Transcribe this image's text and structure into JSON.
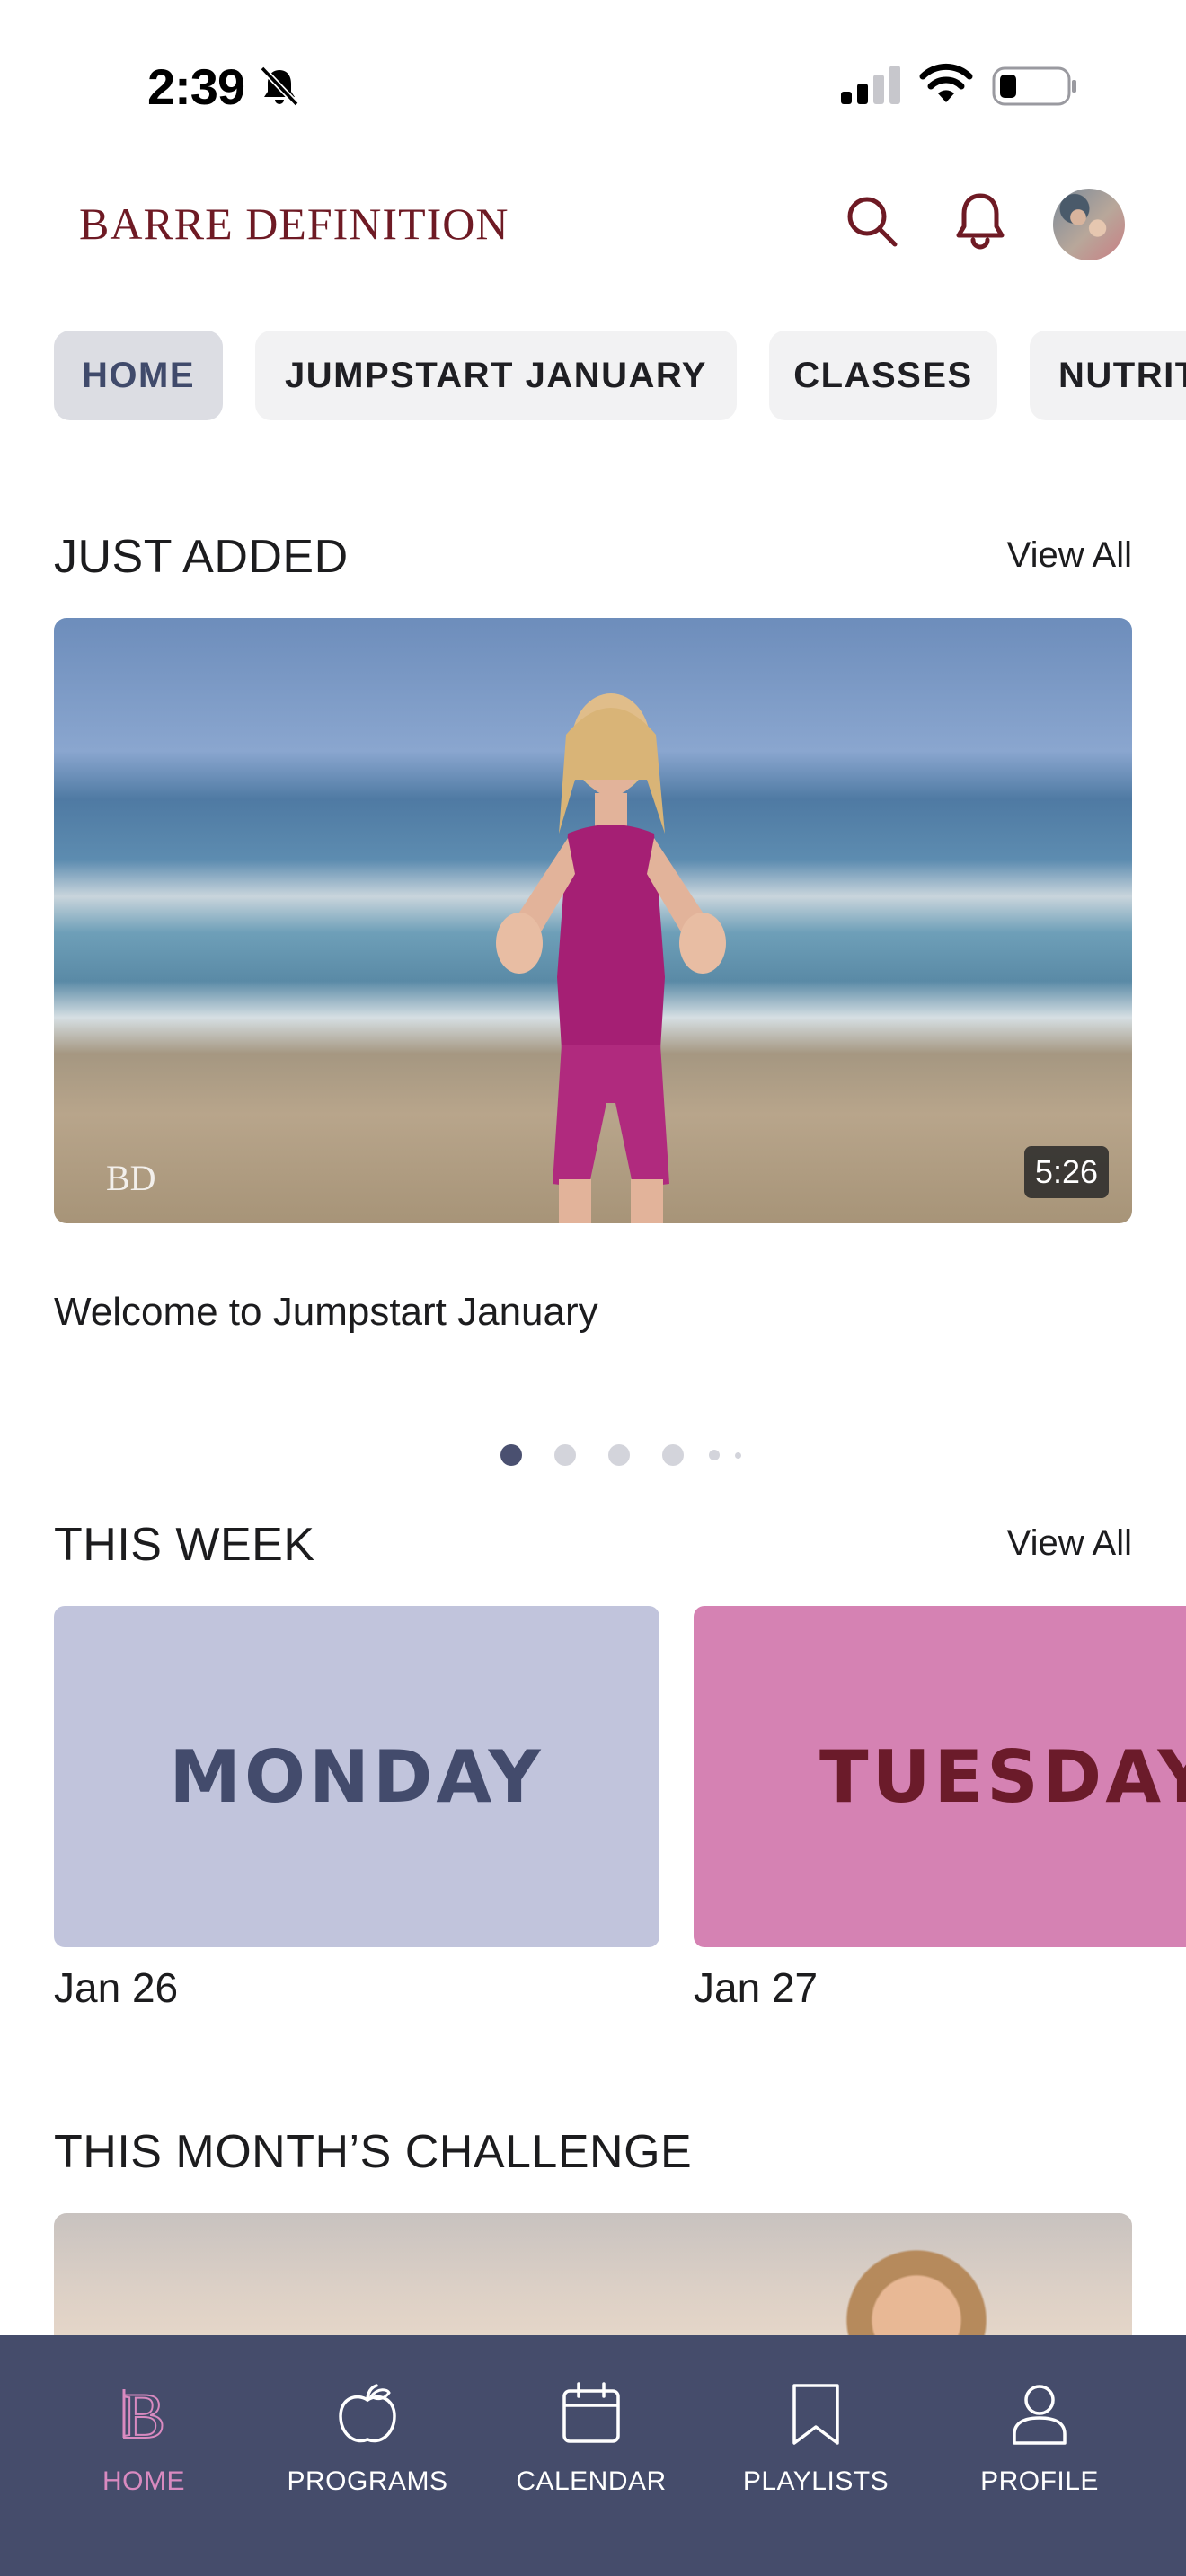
{
  "status": {
    "time": "2:39",
    "icons": [
      "bell-slash-icon",
      "cellular-signal-icon",
      "wifi-icon",
      "battery-icon"
    ]
  },
  "header": {
    "brand": "BARRE DEFINITION",
    "icons": [
      "search-icon",
      "notification-bell-icon",
      "profile-avatar"
    ]
  },
  "tabs": [
    {
      "label": "HOME",
      "active": true
    },
    {
      "label": "JUMPSTART JANUARY",
      "active": false
    },
    {
      "label": "CLASSES",
      "active": false
    },
    {
      "label": "NUTRITION",
      "active": false
    }
  ],
  "just_added": {
    "title": "JUST ADDED",
    "view_all": "View All",
    "video": {
      "title": "Welcome to Jumpstart January",
      "duration": "5:26",
      "watermark": "BD"
    },
    "carousel": {
      "count": 6,
      "active_index": 0
    }
  },
  "this_week": {
    "title": "THIS WEEK",
    "view_all": "View All",
    "days": [
      {
        "day": "MONDAY",
        "date": "Jan 26"
      },
      {
        "day": "TUESDAY",
        "date": "Jan 27"
      }
    ]
  },
  "challenge": {
    "title": "THIS MONTH’S CHALLENGE"
  },
  "bottom_nav": [
    {
      "label": "HOME",
      "icon": "bd-logo-icon",
      "active": true
    },
    {
      "label": "PROGRAMS",
      "icon": "apple-icon",
      "active": false
    },
    {
      "label": "CALENDAR",
      "icon": "calendar-icon",
      "active": false
    },
    {
      "label": "PLAYLISTS",
      "icon": "bookmark-icon",
      "active": false
    },
    {
      "label": "PROFILE",
      "icon": "person-icon",
      "active": false
    }
  ],
  "colors": {
    "brand": "#6e1a24",
    "nav_background": "#454c6b",
    "nav_active": "#d98ac0",
    "monday_card": "#c1c4dc",
    "tuesday_card": "#d582b3"
  }
}
